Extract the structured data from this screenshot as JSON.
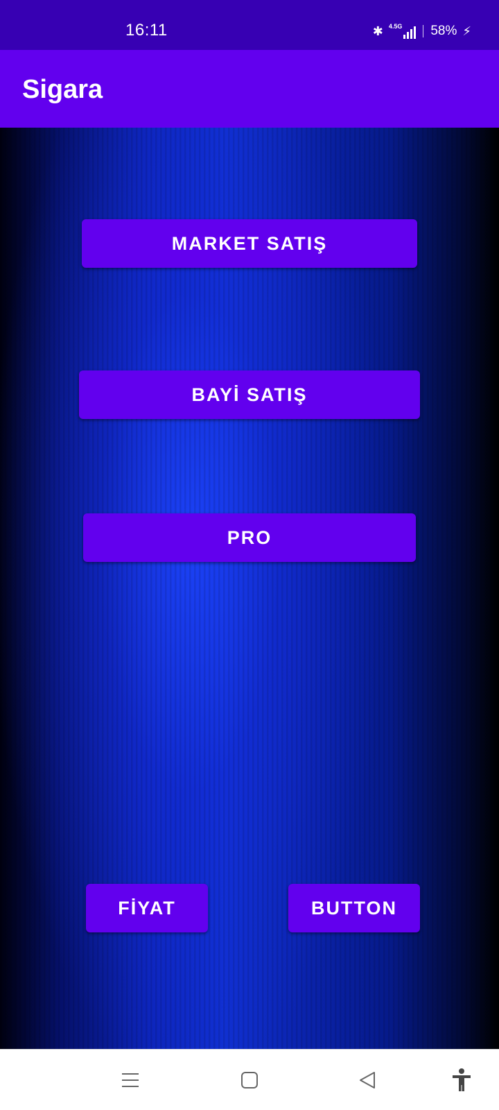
{
  "status_bar": {
    "time": "16:11",
    "network_label": "4.5G",
    "battery": "58%"
  },
  "app_bar": {
    "title": "Sigara"
  },
  "buttons": {
    "market": "MARKET SATIŞ",
    "bayi": "BAYİ SATIŞ",
    "pro": "PRO",
    "fiyat": "FİYAT",
    "button": "BUTTON"
  },
  "nav_bar": {
    "icons": [
      "menu-icon",
      "home-icon",
      "back-icon",
      "accessibility-icon"
    ]
  },
  "colors": {
    "status_bar": "#3700b3",
    "primary": "#6200ee",
    "text_on_primary": "#ffffff",
    "background_blue": "#1030d0"
  }
}
